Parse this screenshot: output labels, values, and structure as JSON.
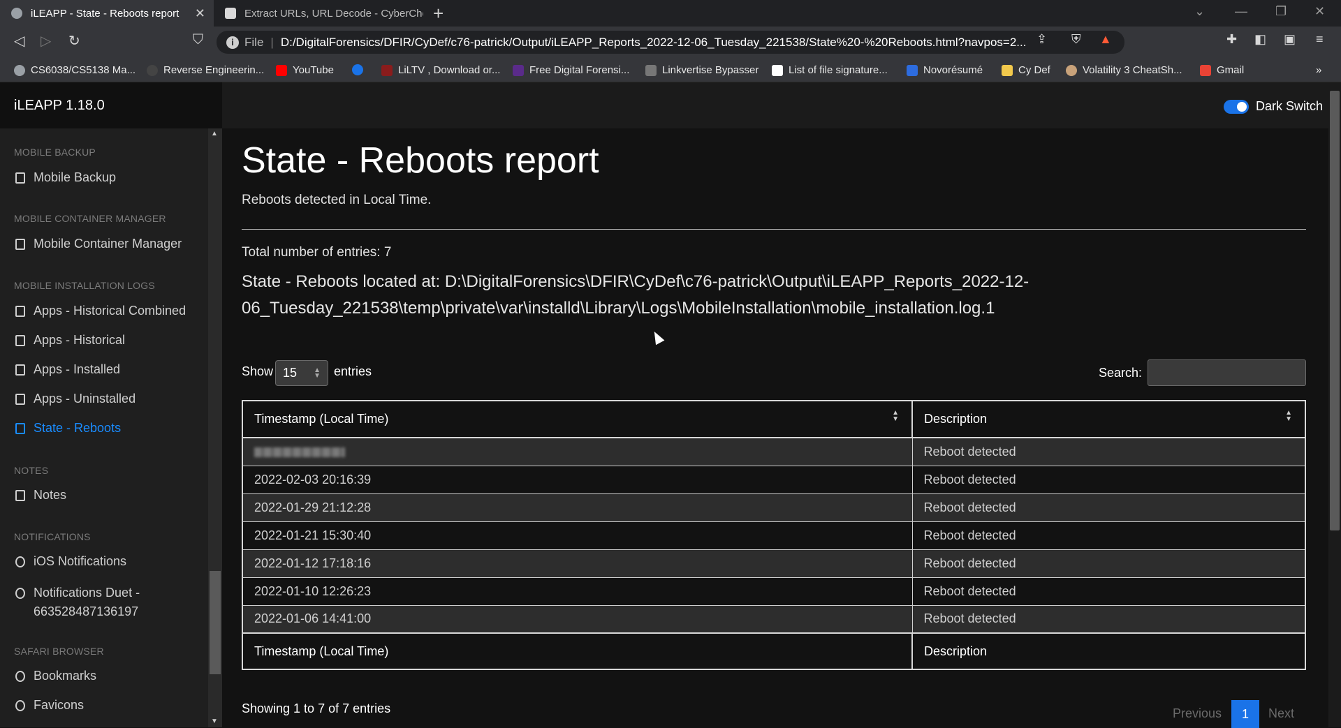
{
  "browser": {
    "tabs": [
      {
        "title": "iLEAPP - State - Reboots report",
        "active": true
      },
      {
        "title": "Extract URLs, URL Decode - CyberChef",
        "active": false
      }
    ],
    "address": {
      "scheme_label": "File",
      "url": "D:/DigitalForensics/DFIR/CyDef/c76-patrick/Output/iLEAPP_Reports_2022-12-06_Tuesday_221538/State%20-%20Reboots.html?navpos=2..."
    },
    "bookmarks": [
      {
        "label": "CS6038/CS5138 Ma...",
        "icon": "globe-icon"
      },
      {
        "label": "Reverse Engineerin...",
        "icon": "site-icon"
      },
      {
        "label": "YouTube",
        "icon": "youtube-icon"
      },
      {
        "label": "",
        "icon": "play-icon"
      },
      {
        "label": "LiLTV , Download or...",
        "icon": "site-icon"
      },
      {
        "label": "Free Digital Forensi...",
        "icon": "site-icon"
      },
      {
        "label": "Linkvertise Bypasser",
        "icon": "site-icon"
      },
      {
        "label": "List of file signature...",
        "icon": "wikipedia-icon"
      },
      {
        "label": "Novorésumé",
        "icon": "site-icon"
      },
      {
        "label": "Cy Def",
        "icon": "folder-icon"
      },
      {
        "label": "Volatility 3 CheatSh...",
        "icon": "site-icon"
      },
      {
        "label": "Gmail",
        "icon": "gmail-icon"
      }
    ]
  },
  "app": {
    "brand": "iLEAPP 1.18.0",
    "dark_switch_label": "Dark Switch"
  },
  "sidebar": {
    "sections": [
      {
        "title": "MOBILE BACKUP",
        "items": [
          "Mobile Backup"
        ]
      },
      {
        "title": "MOBILE CONTAINER MANAGER",
        "items": [
          "Mobile Container Manager"
        ]
      },
      {
        "title": "MOBILE INSTALLATION LOGS",
        "items": [
          "Apps - Historical Combined",
          "Apps - Historical",
          "Apps - Installed",
          "Apps - Uninstalled",
          "State - Reboots"
        ]
      },
      {
        "title": "NOTES",
        "items": [
          "Notes"
        ]
      },
      {
        "title": "NOTIFICATIONS",
        "items": [
          "iOS Notifications",
          "Notifications Duet - 663528487136197"
        ]
      },
      {
        "title": "SAFARI BROWSER",
        "items": [
          "Bookmarks",
          "Favicons"
        ]
      }
    ],
    "active_item": "State - Reboots"
  },
  "report": {
    "title": "State - Reboots report",
    "subtitle": "Reboots detected in Local Time.",
    "total": "Total number of entries: 7",
    "located": "State - Reboots located at: D:\\DigitalForensics\\DFIR\\CyDef\\c76-patrick\\Output\\iLEAPP_Reports_2022-12-06_Tuesday_221538\\temp\\private\\var\\installd\\Library\\Logs\\MobileInstallation\\mobile_installation.log.1",
    "show_label": "Show",
    "show_value": "15",
    "entries_label": "entries",
    "search_label": "Search:",
    "search_value": "",
    "columns": [
      "Timestamp (Local Time)",
      "Description"
    ],
    "rows": [
      {
        "timestamp": "",
        "description": "Reboot detected",
        "redacted": true
      },
      {
        "timestamp": "2022-02-03 20:16:39",
        "description": "Reboot detected"
      },
      {
        "timestamp": "2022-01-29 21:12:28",
        "description": "Reboot detected"
      },
      {
        "timestamp": "2022-01-21 15:30:40",
        "description": "Reboot detected"
      },
      {
        "timestamp": "2022-01-12 17:18:16",
        "description": "Reboot detected"
      },
      {
        "timestamp": "2022-01-10 12:26:23",
        "description": "Reboot detected"
      },
      {
        "timestamp": "2022-01-06 14:41:00",
        "description": "Reboot detected"
      }
    ],
    "showing": "Showing 1 to 7 of 7 entries",
    "pagination": {
      "previous": "Previous",
      "current": "1",
      "next": "Next"
    }
  },
  "colors": {
    "accent": "#1a8cff",
    "toggle": "#1a73e8",
    "background": "#121212"
  }
}
